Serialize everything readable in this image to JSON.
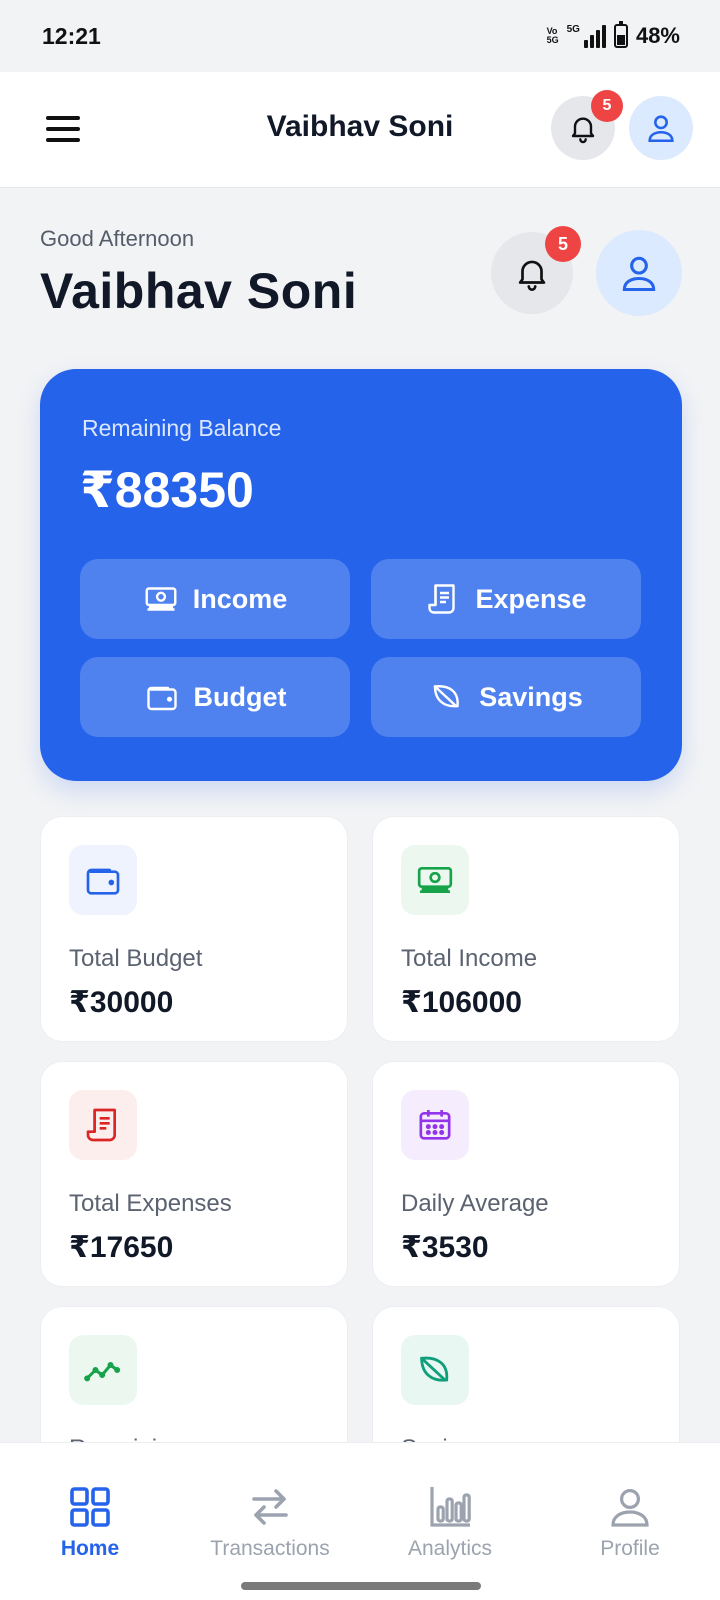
{
  "status_bar": {
    "time": "12:21",
    "network_label": "5G",
    "volte_label_top": "Vo",
    "volte_label_bottom": "5G",
    "battery": "48%",
    "battery_level": 0.48
  },
  "header": {
    "title": "Vaibhav Soni",
    "notification_count": "5"
  },
  "greeting": {
    "text": "Good Afternoon",
    "name": "Vaibhav Soni",
    "notification_count": "5"
  },
  "balance_card": {
    "label": "Remaining Balance",
    "value": "₹88350",
    "actions": {
      "income": "Income",
      "expense": "Expense",
      "budget": "Budget",
      "savings": "Savings"
    }
  },
  "stats": [
    {
      "label": "Total Budget",
      "value": "₹30000",
      "icon": "wallet-icon",
      "color": "#2563eb",
      "bg": "#eef3fe"
    },
    {
      "label": "Total Income",
      "value": "₹106000",
      "icon": "cash-icon",
      "color": "#16a34a",
      "bg": "#ecf8ef"
    },
    {
      "label": "Total Expenses",
      "value": "₹17650",
      "icon": "receipt-icon",
      "color": "#dc2626",
      "bg": "#fdeeee"
    },
    {
      "label": "Daily Average",
      "value": "₹3530",
      "icon": "calendar-icon",
      "color": "#9333ea",
      "bg": "#f5edfd"
    },
    {
      "label": "Remaining",
      "value": "",
      "icon": "trend-icon",
      "color": "#16a34a",
      "bg": "#ecf8ef"
    },
    {
      "label": "Savings",
      "value": "",
      "icon": "leaf-icon",
      "color": "#0f9f7a",
      "bg": "#e9f7f2"
    }
  ],
  "bottom_nav": {
    "items": [
      {
        "label": "Home",
        "icon": "grid-icon",
        "active": true
      },
      {
        "label": "Transactions",
        "icon": "swap-icon",
        "active": false
      },
      {
        "label": "Analytics",
        "icon": "bar-chart-icon",
        "active": false
      },
      {
        "label": "Profile",
        "icon": "person-icon",
        "active": false
      }
    ]
  },
  "colors": {
    "accent": "#2563eb",
    "badge": "#ef4444",
    "background": "#f2f3f5"
  }
}
